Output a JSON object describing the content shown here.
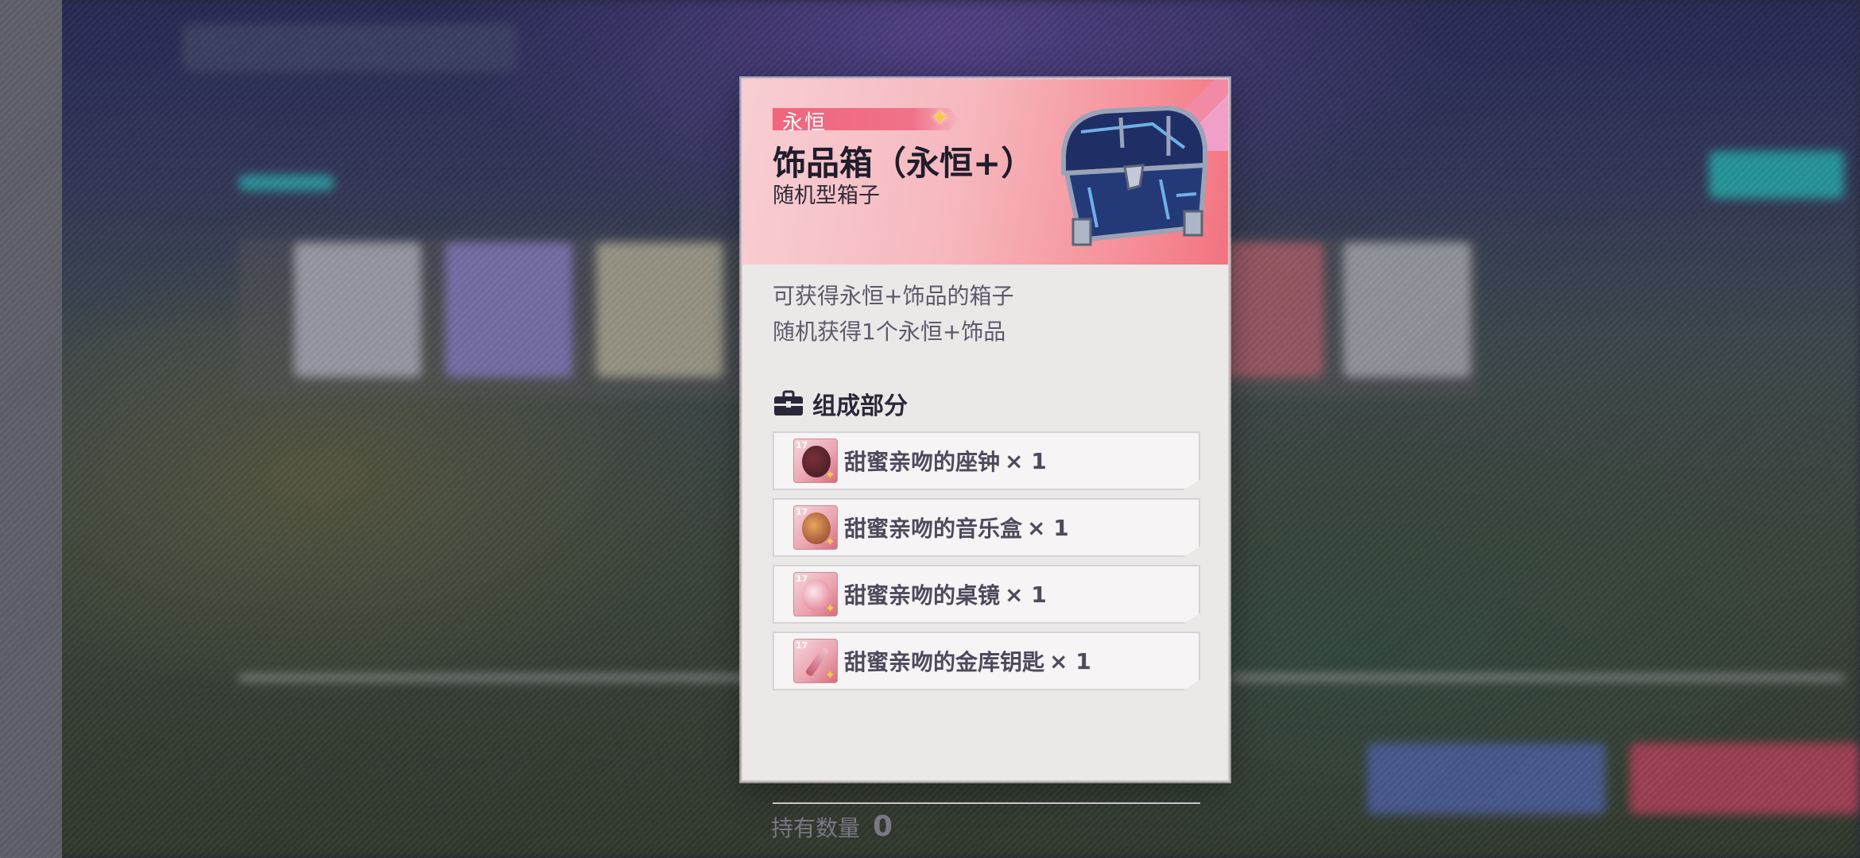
{
  "popup": {
    "rarity": "永恒",
    "title": "饰品箱（永恒+）",
    "type": "随机型箱子",
    "description": [
      "可获得永恒+饰品的箱子",
      "随机获得1个永恒+饰品"
    ],
    "components_title": "组成部分",
    "components": [
      {
        "name": "甜蜜亲吻的座钟",
        "qty": "× 1",
        "icon": "table-clock-icon"
      },
      {
        "name": "甜蜜亲吻的音乐盒",
        "qty": "× 1",
        "icon": "music-box-icon"
      },
      {
        "name": "甜蜜亲吻的桌镜",
        "qty": "× 1",
        "icon": "table-mirror-icon"
      },
      {
        "name": "甜蜜亲吻的金库钥匙",
        "qty": "× 1",
        "icon": "vault-key-icon"
      }
    ],
    "owned_label": "持有数量",
    "owned_count": "0"
  },
  "colors": {
    "header_pink": "#f6b8be",
    "rarity_tag": "#f0667c",
    "accent_gold": "#f7c949",
    "panel_bg": "#ebe8e8"
  }
}
